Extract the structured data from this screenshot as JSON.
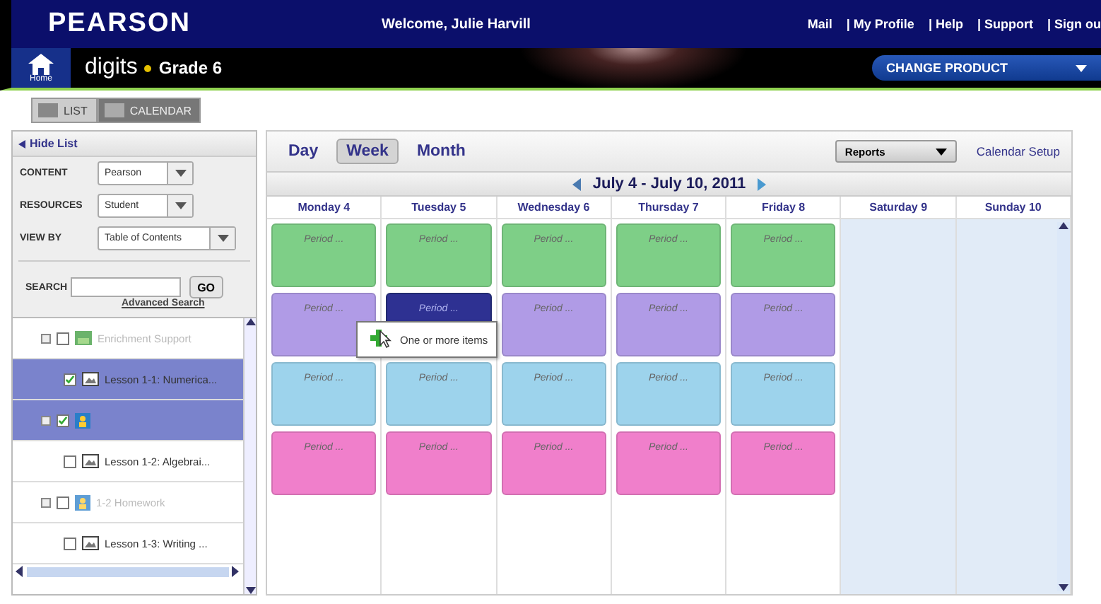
{
  "header": {
    "brand": "PEARSON",
    "welcome": "Welcome, Julie Harvill",
    "links": [
      "Mail",
      "| My Profile",
      "| Help",
      "| Support",
      "| Sign ou"
    ]
  },
  "product_bar": {
    "home_label": "Home",
    "product": "digits",
    "grade": "Grade 6",
    "dropdown": "CHANGE PRODUCT"
  },
  "view_toggle": [
    {
      "label": "LIST",
      "selected": false
    },
    {
      "label": "CALENDAR",
      "selected": true
    }
  ],
  "sidebar": {
    "hide_label": "Hide List",
    "filters": [
      {
        "label": "CONTENT",
        "value": "Pearson"
      },
      {
        "label": "RESOURCES",
        "value": "Student"
      },
      {
        "label": "VIEW BY",
        "value": "Table of Contents"
      }
    ],
    "search": {
      "label": "SEARCH",
      "button": "GO",
      "link": "Advanced Search"
    },
    "tree": [
      {
        "label": "Enrichment Support",
        "kind": "folder",
        "expandable": true,
        "checked": false,
        "selected": false,
        "disabled": true
      },
      {
        "label": "Lesson 1-1: Numerica...",
        "kind": "picture",
        "expandable": false,
        "checked": true,
        "selected": true,
        "disabled": false
      },
      {
        "kind": "person",
        "expandable": true,
        "checked": true,
        "selected": true,
        "disabled": false
      },
      {
        "label": "Lesson 1-2: Algebrai...",
        "kind": "picture",
        "expandable": false,
        "checked": false,
        "selected": false,
        "disabled": false
      },
      {
        "label": "1-2 Homework",
        "kind": "person",
        "expandable": true,
        "checked": false,
        "selected": false,
        "disabled": true
      },
      {
        "label": "Lesson 1-3: Writing ...",
        "kind": "picture",
        "expandable": false,
        "checked": false,
        "selected": false,
        "disabled": false
      }
    ]
  },
  "calendar": {
    "tabs": [
      {
        "label": "Day",
        "selected": false
      },
      {
        "label": "Week",
        "selected": true
      },
      {
        "label": "Month",
        "selected": false
      }
    ],
    "reports": "Reports",
    "setup": "Calendar Setup",
    "range": "July 4 - July 10, 2011",
    "days": [
      {
        "label": "Monday 4",
        "weekend": false
      },
      {
        "label": "Tuesday 5",
        "weekend": false
      },
      {
        "label": "Wednesday 6",
        "weekend": false
      },
      {
        "label": "Thursday 7",
        "weekend": false
      },
      {
        "label": "Friday 8",
        "weekend": false
      },
      {
        "label": "Saturday 9",
        "weekend": true
      },
      {
        "label": "Sunday 10",
        "weekend": true
      }
    ],
    "period_rows": [
      {
        "color": "#7ecf87",
        "cells": [
          {
            "text": "Period ...",
            "selected": false
          },
          {
            "text": "Period ...",
            "selected": false
          },
          {
            "text": "Period ...",
            "selected": false
          },
          {
            "text": "Period ...",
            "selected": false
          },
          {
            "text": "Period ...",
            "selected": false
          }
        ]
      },
      {
        "color": "#b09be6",
        "cells": [
          {
            "text": "Period ...",
            "selected": false
          },
          {
            "text": "Period ...",
            "selected": true
          },
          {
            "text": "Period ...",
            "selected": false
          },
          {
            "text": "Period ...",
            "selected": false
          },
          {
            "text": "Period ...",
            "selected": false
          }
        ]
      },
      {
        "color": "#9dd3ec",
        "cells": [
          {
            "text": "Period ...",
            "selected": false
          },
          {
            "text": "Period ...",
            "selected": false
          },
          {
            "text": "Period ...",
            "selected": false
          },
          {
            "text": "Period ...",
            "selected": false
          },
          {
            "text": "Period ...",
            "selected": false
          }
        ]
      },
      {
        "color": "#f07fcb",
        "cells": [
          {
            "text": "Period ...",
            "selected": false
          },
          {
            "text": "Period ...",
            "selected": false
          },
          {
            "text": "Period ...",
            "selected": false
          },
          {
            "text": "Period ...",
            "selected": false
          },
          {
            "text": "Period ...",
            "selected": false
          }
        ]
      }
    ],
    "tooltip": "One or more items"
  }
}
